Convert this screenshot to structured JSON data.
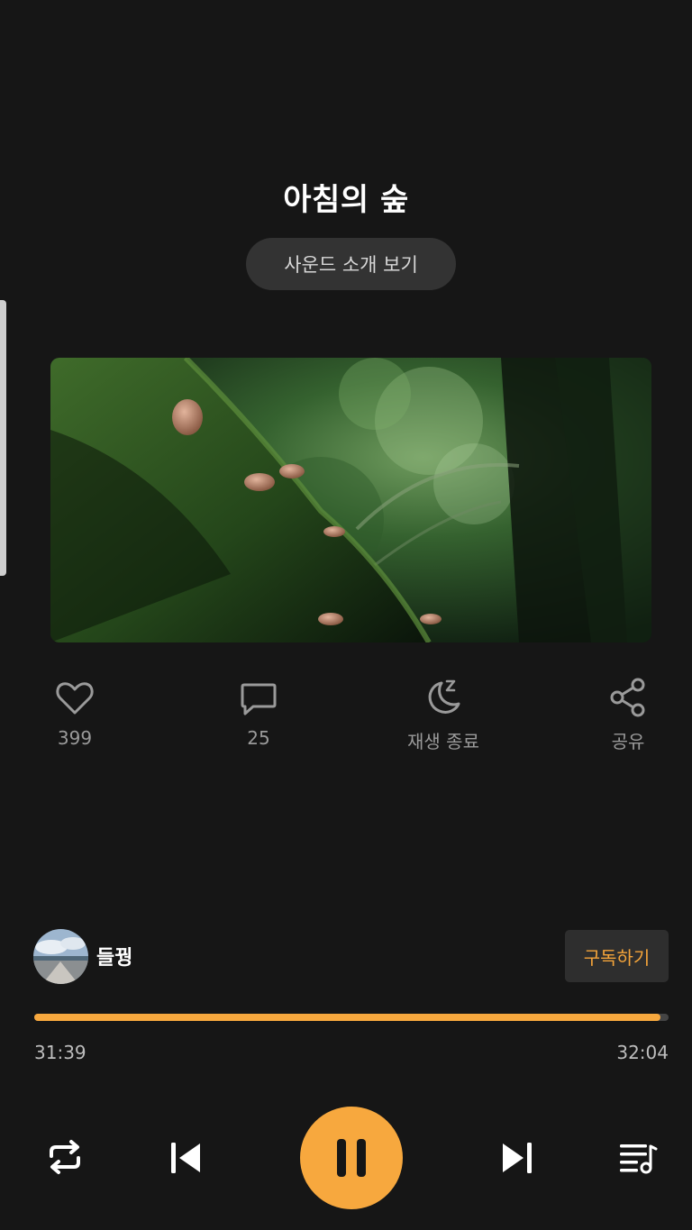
{
  "track": {
    "title": "아침의 숲",
    "intro_label": "사운드 소개 보기"
  },
  "artwork": {
    "subject": "moss-covered tree trunk with small mushrooms in a forest"
  },
  "actions": {
    "like": {
      "icon": "heart-icon",
      "label": "399"
    },
    "comment": {
      "icon": "comment-icon",
      "label": "25"
    },
    "sleep_timer": {
      "icon": "moon-sleep-icon",
      "label": "재생 종료"
    },
    "share": {
      "icon": "share-icon",
      "label": "공유"
    }
  },
  "creator": {
    "name": "들꿩",
    "subscribe_label": "구독하기"
  },
  "player": {
    "elapsed": "31:39",
    "total": "32:04",
    "progress": 0.987,
    "controls": [
      "repeat-icon",
      "previous-icon",
      "pause-icon",
      "next-icon",
      "playlist-icon"
    ]
  },
  "colors": {
    "background": "#161616",
    "accent": "#f7a83e",
    "muted_text": "#9a9a9a"
  }
}
